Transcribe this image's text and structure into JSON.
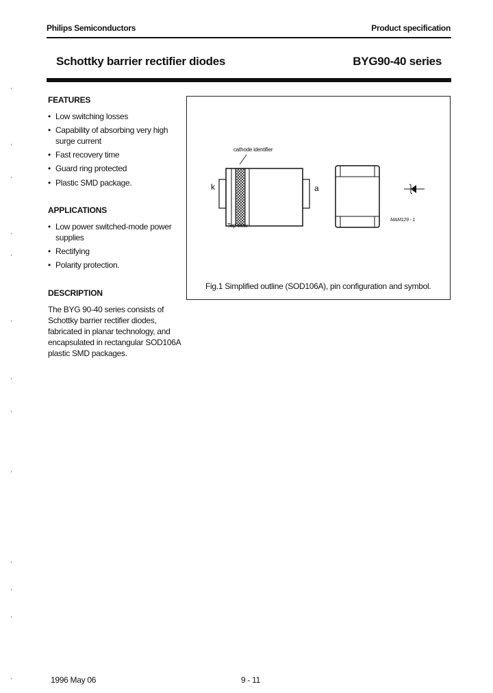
{
  "header": {
    "company": "Philips Semiconductors",
    "doc_type": "Product specification"
  },
  "title": {
    "product_name": "Schottky barrier rectifier diodes",
    "series": "BYG90-40 series"
  },
  "features": {
    "heading": "FEATURES",
    "items": [
      "Low switching losses",
      "Capability of absorbing very high surge current",
      "Fast recovery time",
      "Guard ring protected",
      "Plastic SMD package."
    ]
  },
  "applications": {
    "heading": "APPLICATIONS",
    "items": [
      "Low power switched-mode power supplies",
      "Rectifying",
      "Polarity protection."
    ]
  },
  "description": {
    "heading": "DESCRIPTION",
    "text": "The BYG 90-40 series consists of Schottky barrier rectifier diodes, fabricated in planar technology, and encapsulated in rectangular SOD106A plastic SMD packages."
  },
  "figure": {
    "cathode_label": "cathode identifier",
    "pin_k": "k",
    "pin_a": "a",
    "view_label": "Top view",
    "drawing_code": "MAM129 - 1",
    "caption": "Fig.1  Simplified outline (SOD106A), pin configuration and symbol."
  },
  "footer": {
    "date": "1996 May 06",
    "page": "9 - 11"
  },
  "bullet": "•"
}
